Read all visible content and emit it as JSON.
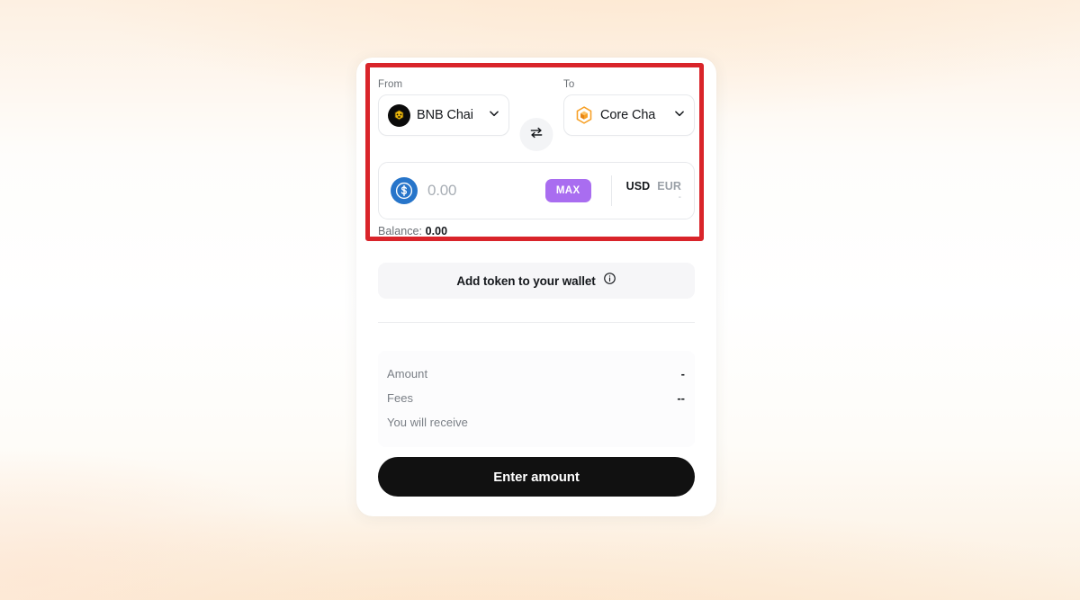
{
  "background": {
    "accent": "#fde7cf",
    "base": "#ffffff"
  },
  "annotation": {
    "highlight_color": "#d9242a"
  },
  "bridge": {
    "from": {
      "label": "From",
      "chain_name": "BNB Chai",
      "chain_icon": "bnb-chain-icon",
      "chevron_icon": "chevron-down-icon"
    },
    "swap": {
      "icon": "swap-arrows-icon"
    },
    "to": {
      "label": "To",
      "chain_name": "Core Cha",
      "chain_icon": "core-chain-icon",
      "chevron_icon": "chevron-down-icon"
    },
    "amount": {
      "token_icon": "usdc-token-icon",
      "value": "",
      "placeholder": "0.00",
      "max_label": "MAX",
      "fiat": {
        "options": [
          "USD",
          "EUR"
        ],
        "selected": "USD",
        "usd_label": "USD",
        "eur_label": "EUR",
        "converted_value": "-"
      }
    },
    "balance": {
      "label": "Balance:",
      "value": "0.00"
    },
    "add_token": {
      "label": "Add token to your wallet",
      "info_icon": "info-circle-icon"
    },
    "summary": {
      "rows": [
        {
          "key": "Amount",
          "value": "-"
        },
        {
          "key": "Fees",
          "value": "--"
        },
        {
          "key": "You will receive",
          "value": ""
        }
      ]
    },
    "cta": {
      "label": "Enter amount"
    },
    "colors": {
      "max_button": "#a96df0",
      "cta_background": "#111111",
      "usdc_blue": "#2775ca",
      "core_orange": "#f7931a"
    }
  }
}
